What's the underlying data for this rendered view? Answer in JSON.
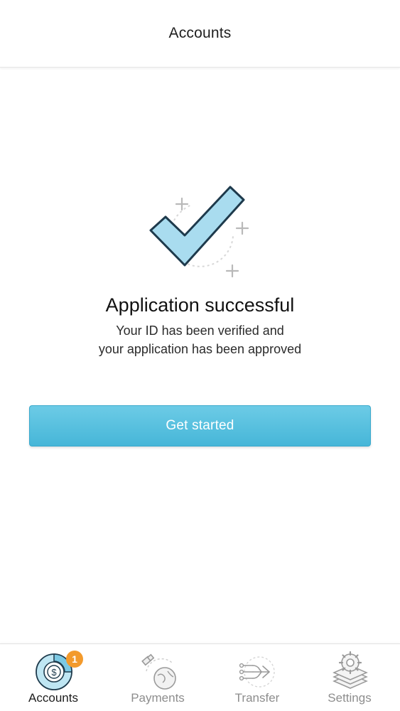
{
  "header": {
    "title": "Accounts"
  },
  "content": {
    "heading": "Application successful",
    "message_line1": "Your ID has been verified and",
    "message_line2": "your application has been approved",
    "primary_button_label": "Get started",
    "illustration_icon": "checkmark-icon"
  },
  "bottom_nav": {
    "items": [
      {
        "label": "Accounts",
        "icon": "accounts-icon",
        "active": true,
        "badge": "1"
      },
      {
        "label": "Payments",
        "icon": "payments-icon",
        "active": false
      },
      {
        "label": "Transfer",
        "icon": "transfer-icon",
        "active": false
      },
      {
        "label": "Settings",
        "icon": "settings-icon",
        "active": false
      }
    ]
  },
  "colors": {
    "accent": "#4fbbdc",
    "check_fill": "#a9dcef",
    "check_stroke": "#1e3a4c",
    "badge": "#f39a2c"
  }
}
